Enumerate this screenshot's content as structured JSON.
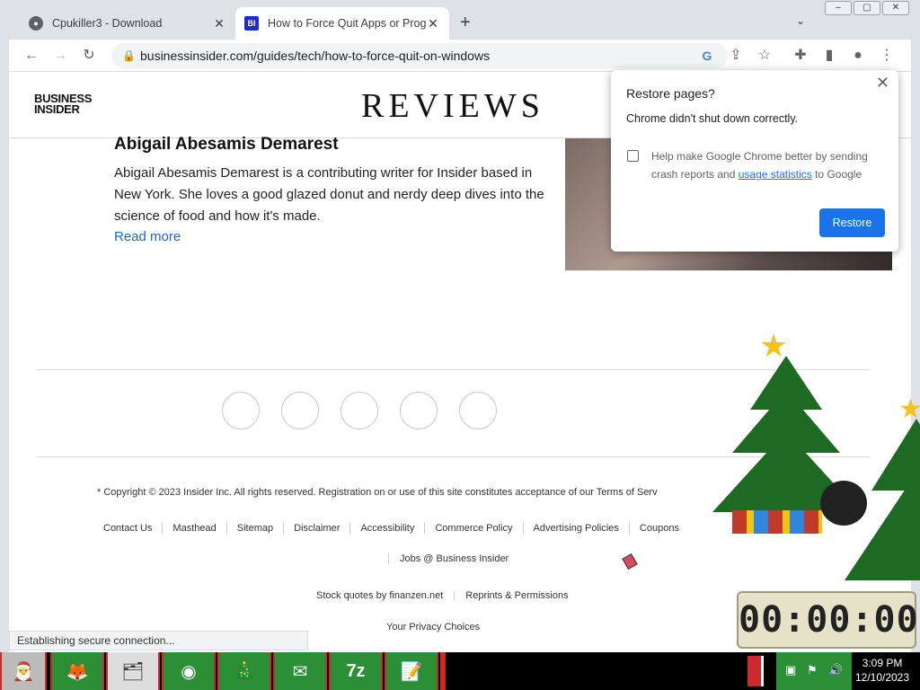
{
  "tabs": [
    {
      "title": "Cpukiller3 - Download",
      "favicon": "globe-icon"
    },
    {
      "title": "How to Force Quit Apps or Progr",
      "favicon": "bi-favicon",
      "favicon_text": "BI"
    }
  ],
  "address": "businessinsider.com/guides/tech/how-to-force-quit-on-windows",
  "header": {
    "logo_line1": "BUSINESS",
    "logo_line2": "INSIDER",
    "section": "REVIEWS"
  },
  "author": {
    "name": "Abigail Abesamis Demarest",
    "bio": "Abigail Abesamis Demarest is a contributing writer for Insider based in New York. She loves a good glazed donut and nerdy deep dives into the science of food and how it's made.",
    "read_more": "Read more"
  },
  "footer": {
    "copyright": "* Copyright © 2023 Insider Inc. All rights reserved. Registration on or use of this site constitutes acceptance of our Terms of Serv",
    "links": [
      "Contact Us",
      "Masthead",
      "Sitemap",
      "Disclaimer",
      "Accessibility",
      "Commerce Policy",
      "Advertising Policies",
      "Coupons"
    ],
    "jobs": "Jobs @ Business Insider",
    "stock_quotes": "Stock quotes by finanzen.net",
    "reprints": "Reprints & Permissions",
    "privacy": "Your Privacy Choices"
  },
  "popup": {
    "title": "Restore pages?",
    "subtitle": "Chrome didn't shut down correctly.",
    "checkbox_text_before": "Help make Google Chrome better by sending crash reports and ",
    "checkbox_link": "usage statistics",
    "checkbox_text_after": " to Google",
    "button": "Restore"
  },
  "status": "Establishing secure connection...",
  "timer": "00:00:00",
  "clock": {
    "time": "3:09 PM",
    "date": "12/10/2023"
  },
  "taskbar_icons": [
    "start-icon",
    "firefox-icon",
    "explorer-icon",
    "chrome-icon",
    "tree-icon",
    "thunderbird-icon",
    "7zip-icon",
    "notepad-icon"
  ],
  "taskbar_labels": {
    "seven_zip": "7z"
  }
}
